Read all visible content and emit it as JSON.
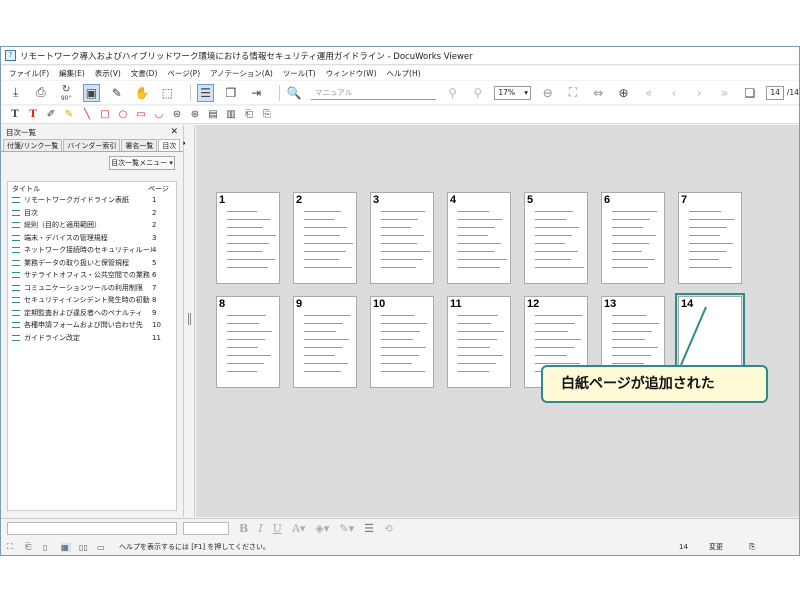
{
  "window": {
    "title": "リモートワーク導入およびハイブリッドワーク環境における情報セキュリティ運用ガイドライン - DocuWorks Viewer"
  },
  "menu": [
    "ファイル(F)",
    "編集(E)",
    "表示(V)",
    "文書(D)",
    "ページ(P)",
    "アノテーション(A)",
    "ツール(T)",
    "ウィンドウ(W)",
    "ヘルプ(H)"
  ],
  "toolbar": {
    "rotate_label": "90°",
    "search_placeholder": "マニュアル",
    "zoom_value": "17%",
    "page_current": "14",
    "page_total": "/14"
  },
  "sidebar": {
    "title": "目次一覧",
    "tabs": [
      "付箋/リンク一覧",
      "バインダー索引",
      "署名一覧",
      "目次"
    ],
    "menu_button": "目次一覧メニュー",
    "col_title": "タイトル",
    "col_page": "ページ",
    "items": [
      {
        "label": "リモートワークガイドライン表紙",
        "page": "1"
      },
      {
        "label": "目次",
        "page": "2"
      },
      {
        "label": "総則（目的と適用範囲）",
        "page": "2"
      },
      {
        "label": "端末・デバイスの管理規程",
        "page": "3"
      },
      {
        "label": "ネットワーク接続時のセキュリティルール",
        "page": "4"
      },
      {
        "label": "業務データの取り扱いと保管規程",
        "page": "5"
      },
      {
        "label": "サテライトオフィス・公共空間での業務",
        "page": "6"
      },
      {
        "label": "コミュニケーションツールの利用制限",
        "page": "7"
      },
      {
        "label": "セキュリティインシデント発生時の初動",
        "page": "8"
      },
      {
        "label": "定期監査および違反者へのペナルティ",
        "page": "9"
      },
      {
        "label": "各種申請フォームおよび問い合わせ先",
        "page": "10"
      },
      {
        "label": "ガイドライン改定",
        "page": "11"
      }
    ]
  },
  "pages": [
    "1",
    "2",
    "3",
    "4",
    "5",
    "6",
    "7",
    "8",
    "9",
    "10",
    "11",
    "12",
    "13",
    "14"
  ],
  "status": {
    "help": "ヘルプを表示するには [F1] を押してください。",
    "page": "14",
    "mode": "変更"
  },
  "callout": {
    "text": "白紙ページが追加された"
  },
  "colors": {
    "accent": "#2e8b8b",
    "callout_bg": "#fffbd6"
  }
}
